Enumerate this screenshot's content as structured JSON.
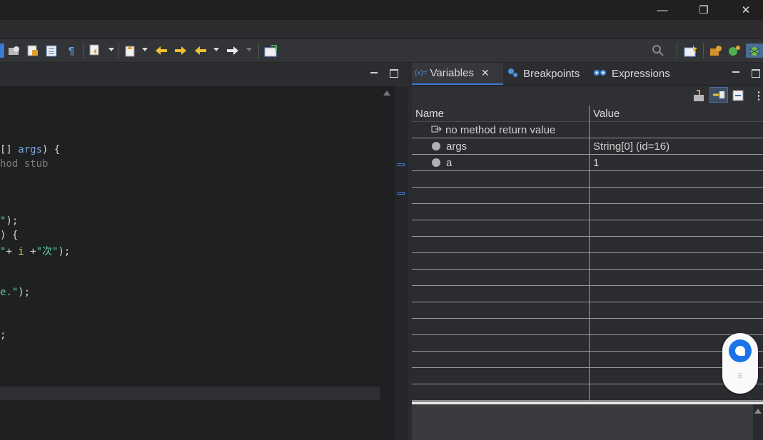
{
  "window": {
    "minimize_glyph": "—",
    "restore_glyph": "❐",
    "close_glyph": "✕"
  },
  "toolbar": {
    "icons": [
      "link-icon",
      "folder-icon",
      "open-type-icon",
      "task-list-icon",
      "pilcrow-icon",
      "next-annotation-icon",
      "prev-annotation-icon",
      "last-edit-icon",
      "back-icon",
      "forward-icon",
      "new-window-icon",
      "search-icon",
      "perspective-open-icon",
      "java-perspective-icon",
      "debug-perspective-icon"
    ],
    "pilcrow": "¶"
  },
  "editor": {
    "lines": [
      {
        "t1": "[] ",
        "v": "args",
        "t2": ") {"
      },
      {
        "cmt": "hod stub"
      },
      {
        "str": "\"",
        "t2": ");"
      },
      {
        "t2": ") {"
      },
      {
        "str": "\"",
        "t2": "+ ",
        "v": "i",
        "t3": " +",
        "str2": "\"次\"",
        "t4": ");"
      },
      {
        "str": "e.\"",
        "t2": ");"
      },
      {
        "t2": ";"
      }
    ]
  },
  "variables_view": {
    "tabs": [
      {
        "label": "Variables",
        "prefix": "(x)="
      },
      {
        "label": "Breakpoints"
      },
      {
        "label": "Expressions"
      }
    ],
    "columns": [
      "Name",
      "Value"
    ],
    "rows": [
      {
        "name": "no method return value",
        "value": ""
      },
      {
        "name": "args",
        "value": "String[0]  (id=16)"
      },
      {
        "name": "a",
        "value": "1"
      }
    ]
  },
  "colors": {
    "accent": "#3a7bd5",
    "background": "#1f2022",
    "float_icon": "#1a73e8"
  }
}
